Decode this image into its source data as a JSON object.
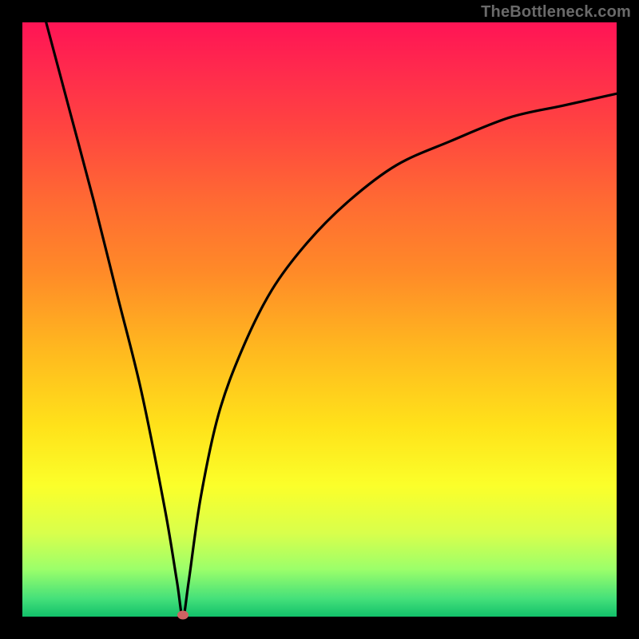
{
  "watermark": "TheBottleneck.com",
  "chart_data": {
    "type": "line",
    "title": "",
    "xlabel": "",
    "ylabel": "",
    "xlim": [
      0,
      100
    ],
    "ylim": [
      0,
      100
    ],
    "grid": false,
    "curve": {
      "description": "Bottleneck curve dipping to ~0 near x≈27 then rising logarithmically toward ~88 at x=100",
      "left_x_at_top": 4,
      "x": [
        4,
        8,
        12,
        16,
        20,
        24,
        26,
        27,
        28,
        30,
        33,
        37,
        42,
        48,
        55,
        63,
        72,
        82,
        91,
        100
      ],
      "y": [
        100,
        85,
        70,
        54,
        38,
        18,
        6,
        0,
        6,
        20,
        34,
        45,
        55,
        63,
        70,
        76,
        80,
        84,
        86,
        88
      ]
    },
    "minimum_marker": {
      "x": 27,
      "y": 0,
      "color": "#d06262"
    },
    "background_gradient": {
      "top": "#ff1455",
      "bottom": "#12c06a",
      "direction": "vertical"
    }
  }
}
